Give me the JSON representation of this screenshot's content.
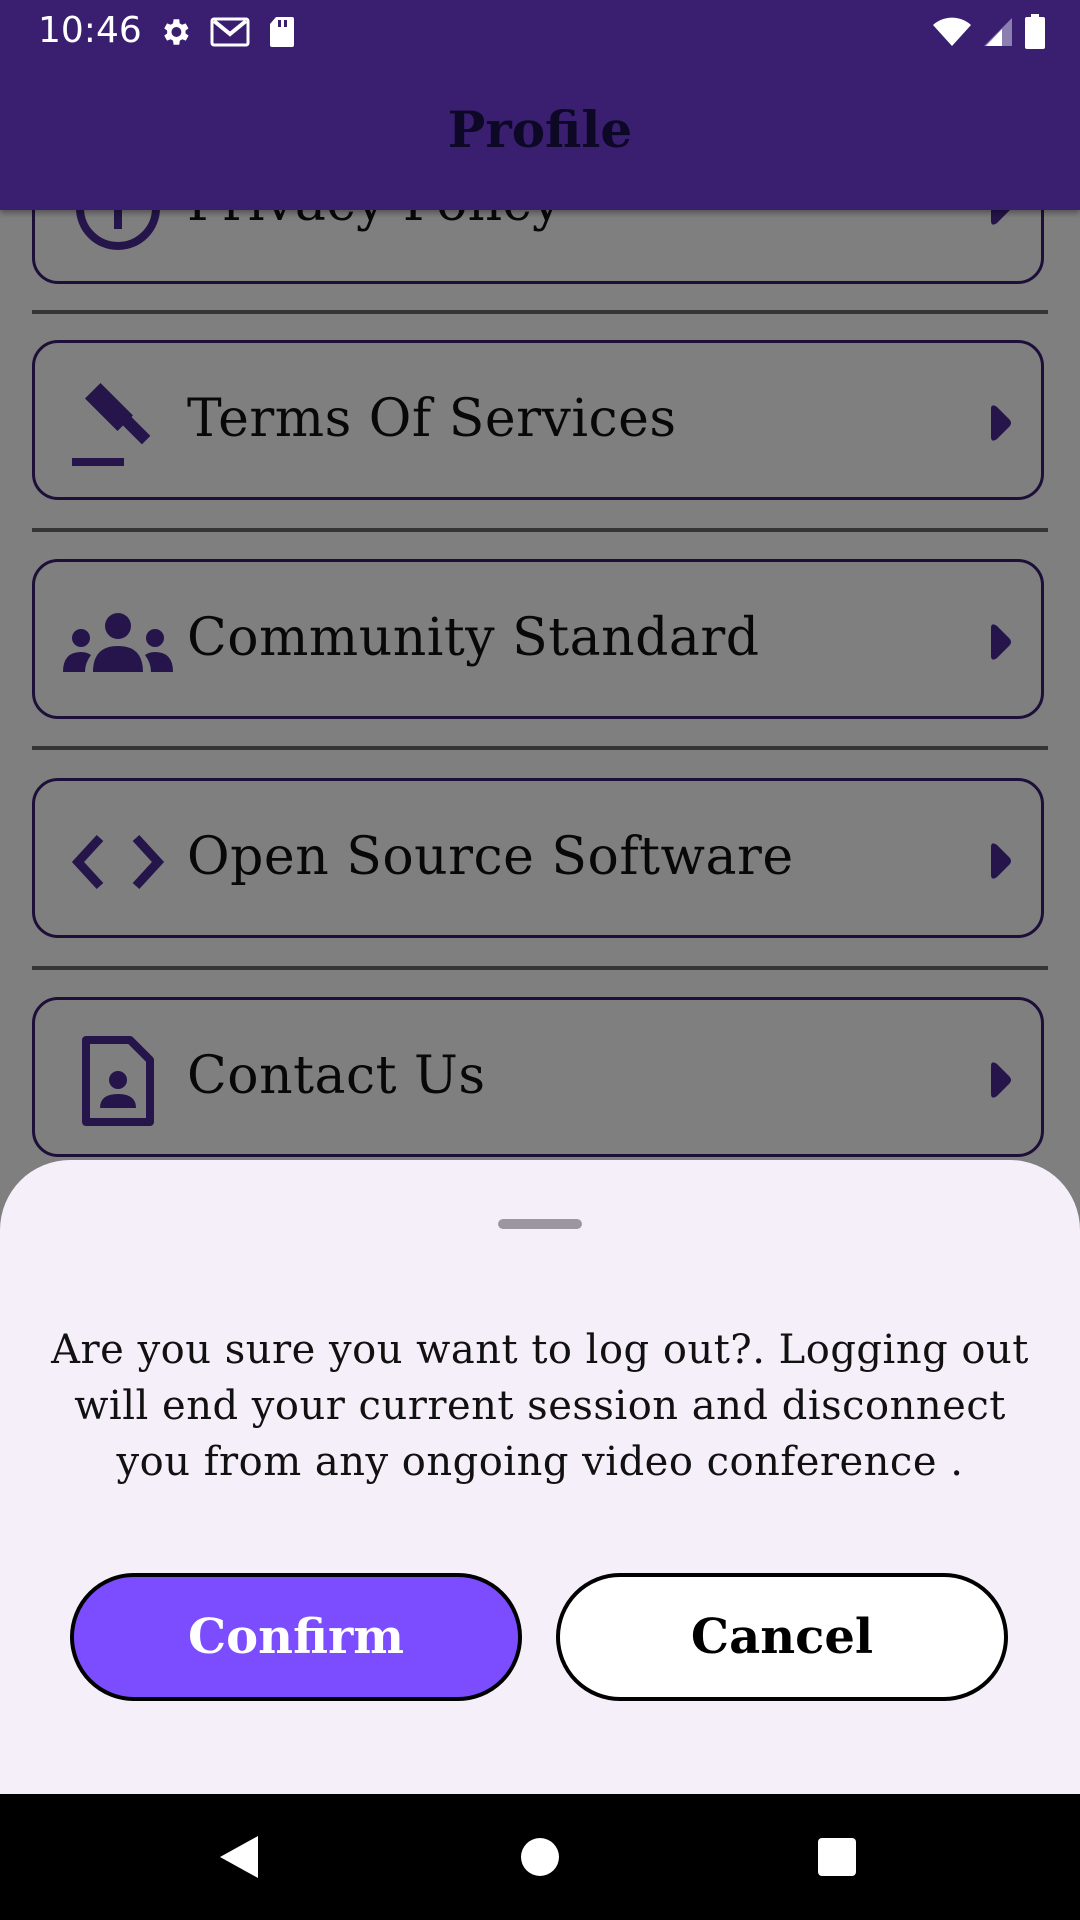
{
  "status_bar": {
    "time": "10:46",
    "left_icons": [
      "settings-icon",
      "gmail-icon",
      "sd-card-icon"
    ],
    "right_icons": [
      "wifi-icon",
      "cellular-signal-icon",
      "battery-icon"
    ]
  },
  "app_bar": {
    "title": "Profile"
  },
  "menu": {
    "items": [
      {
        "label": "Privacy Policy",
        "icon": "info-icon"
      },
      {
        "label": "Terms Of Services",
        "icon": "gavel-icon"
      },
      {
        "label": "Community Standard",
        "icon": "groups-icon"
      },
      {
        "label": "Open Source Software",
        "icon": "code-icon"
      },
      {
        "label": "Contact Us",
        "icon": "contact-page-icon"
      }
    ],
    "accent": "#3a1e70",
    "arrow_color": "#4a2a96"
  },
  "logout_sheet": {
    "message": "Are you sure you want to log out?. Logging out will end your current session and disconnect you from any ongoing video conference .",
    "confirm_label": "Confirm",
    "cancel_label": "Cancel",
    "confirm_color": "#7b4dff"
  },
  "nav_bar": {
    "icons": [
      "back-icon",
      "home-icon",
      "recents-icon"
    ]
  }
}
